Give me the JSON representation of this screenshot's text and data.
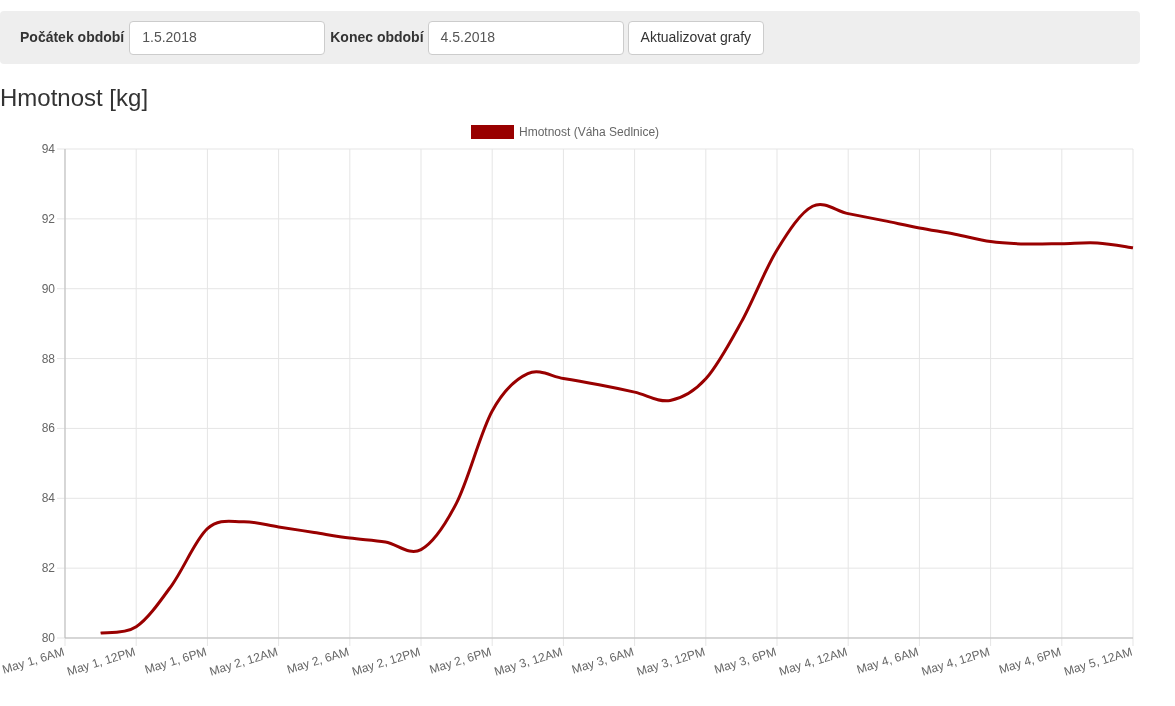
{
  "filter_bar": {
    "start_label": "Počátek období",
    "start_value": "1.5.2018",
    "end_label": "Konec období",
    "end_value": "4.5.2018",
    "update_button": "Aktualizovat grafy"
  },
  "section_title": "Hmotnost [kg]",
  "chart_data": {
    "type": "line",
    "categories": [
      "May 1, 6AM",
      null,
      "May 1, 12PM",
      null,
      "May 1, 6PM",
      null,
      "May 2, 12AM",
      null,
      "May 2, 6AM",
      null,
      "May 2, 12PM",
      null,
      "May 2, 6PM",
      null,
      "May 3, 12AM",
      null,
      "May 3, 6AM",
      null,
      "May 3, 12PM",
      null,
      "May 3, 6PM",
      null,
      "May 4, 12AM",
      null,
      "May 4, 6AM",
      null,
      "May 4, 12PM",
      null,
      "May 4, 6PM",
      null,
      "May 5, 12AM"
    ],
    "series": [
      {
        "name": "Hmotnost (Váha Sedlnice)",
        "color": "#990000",
        "values": [
          null,
          80.14,
          80.32,
          81.51,
          83.13,
          83.33,
          83.18,
          83.02,
          82.86,
          82.75,
          82.53,
          83.87,
          86.5,
          87.57,
          87.43,
          87.25,
          87.04,
          86.8,
          87.42,
          89.05,
          91.11,
          92.36,
          92.15,
          91.95,
          91.74,
          91.56,
          91.35,
          91.28,
          91.29,
          91.31,
          91.17
        ]
      }
    ],
    "ylim": [
      80,
      94
    ],
    "grid": true,
    "yticks": [
      80,
      82,
      84,
      86,
      88,
      90,
      92,
      94
    ]
  }
}
